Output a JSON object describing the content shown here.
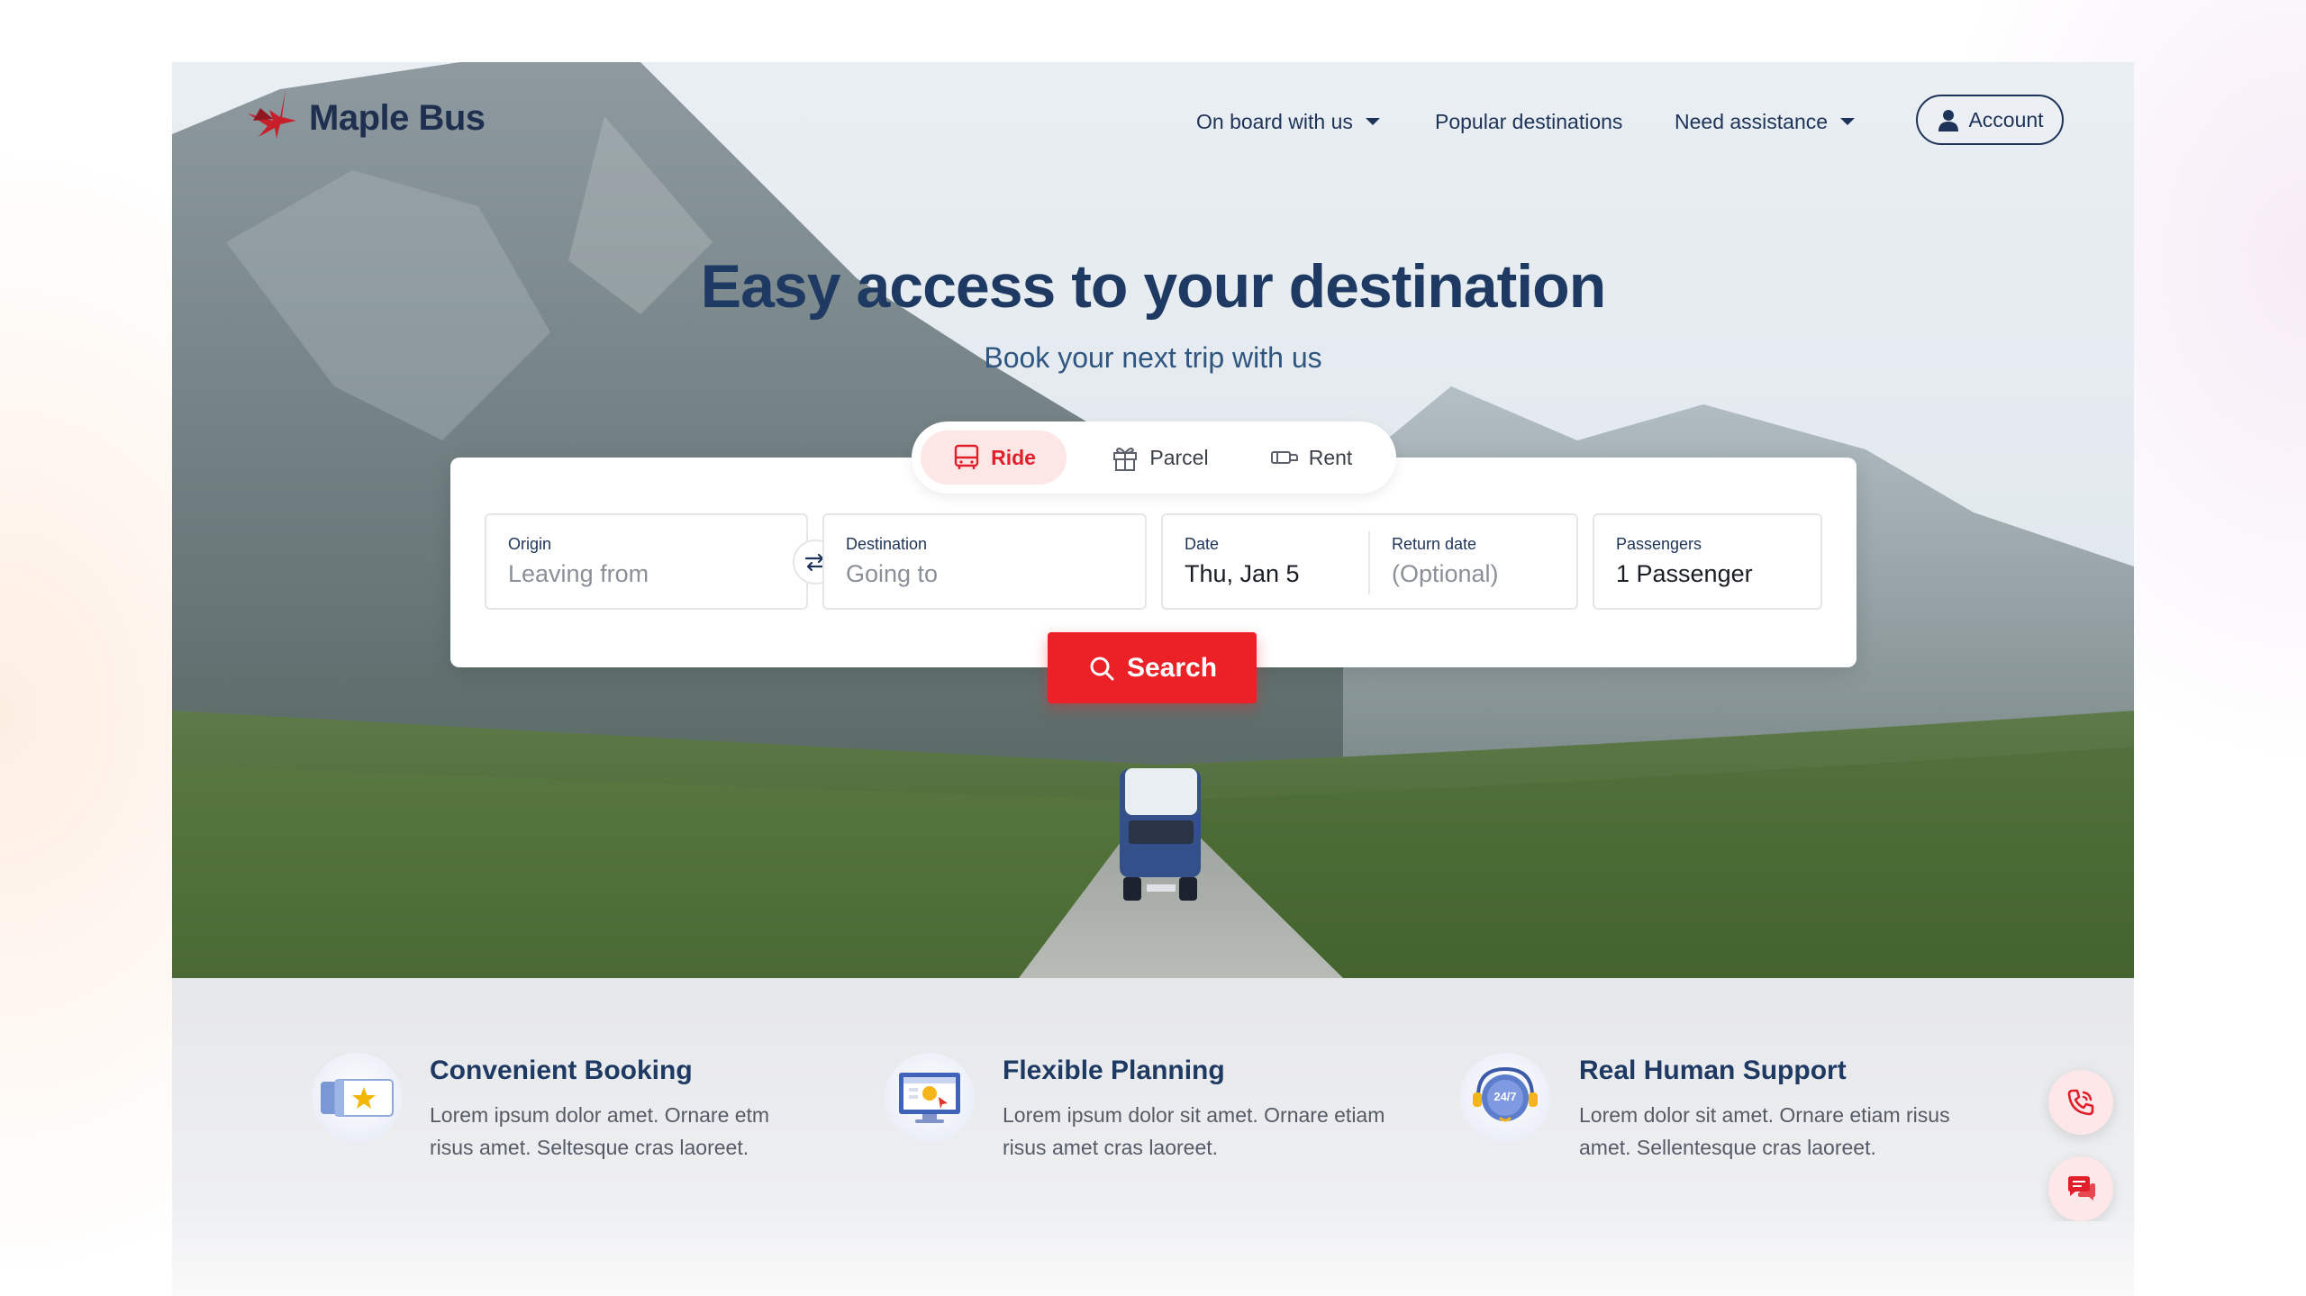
{
  "brand": {
    "name": "Maple Bus",
    "accent": "#ec2027",
    "navy": "#1e3a63"
  },
  "nav": {
    "items": [
      {
        "label": "On board with us",
        "dropdown": true
      },
      {
        "label": "Popular destinations",
        "dropdown": false
      },
      {
        "label": "Need assistance",
        "dropdown": true
      }
    ],
    "account_label": "Account"
  },
  "hero": {
    "title": "Easy access to your destination",
    "subtitle": "Book your next trip with us"
  },
  "tabs": [
    {
      "label": "Ride",
      "icon": "bus-icon",
      "active": true
    },
    {
      "label": "Parcel",
      "icon": "gift-icon",
      "active": false
    },
    {
      "label": "Rent",
      "icon": "van-icon",
      "active": false
    }
  ],
  "search": {
    "origin": {
      "label": "Origin",
      "placeholder": "Leaving from"
    },
    "destination": {
      "label": "Destination",
      "placeholder": "Going to"
    },
    "date": {
      "label": "Date",
      "value": "Thu, Jan 5"
    },
    "return_date": {
      "label": "Return date",
      "placeholder": "(Optional)"
    },
    "passengers": {
      "label": "Passengers",
      "value": "1 Passenger"
    },
    "button_label": "Search"
  },
  "features": [
    {
      "title": "Convenient Booking",
      "text": "Lorem ipsum dolor amet. Ornare etm risus amet. Seltesque cras laoreet.",
      "icon": "ticket-star-icon"
    },
    {
      "title": "Flexible Planning",
      "text": "Lorem ipsum dolor sit amet. Ornare etiam risus amet cras laoreet.",
      "icon": "computer-calendar-icon"
    },
    {
      "title": "Real Human Support",
      "text": "Lorem dolor sit amet. Ornare etiam risus amet. Sellentesque cras laoreet.",
      "icon": "support-24-7-icon"
    }
  ],
  "support_badge": "24/7",
  "floating_actions": [
    {
      "icon": "phone-icon"
    },
    {
      "icon": "chat-icon"
    }
  ]
}
